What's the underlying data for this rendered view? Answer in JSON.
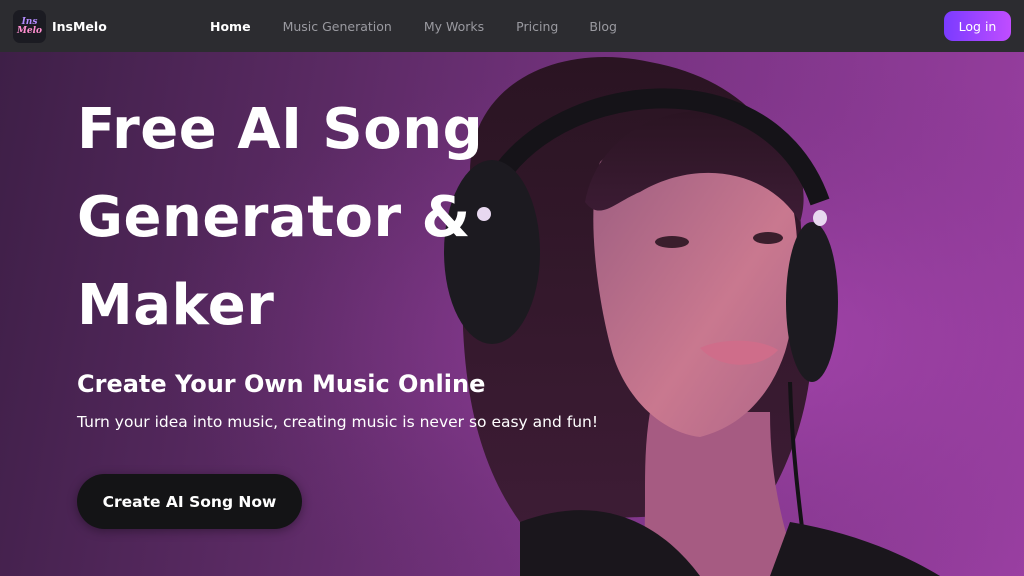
{
  "brand": {
    "logo_text_line1": "Ins",
    "logo_text_line2": "Melo",
    "name": "InsMelo"
  },
  "nav": {
    "items": [
      {
        "label": "Home",
        "active": true
      },
      {
        "label": "Music Generation",
        "active": false
      },
      {
        "label": "My Works",
        "active": false
      },
      {
        "label": "Pricing",
        "active": false
      },
      {
        "label": "Blog",
        "active": false
      }
    ],
    "login_label": "Log in"
  },
  "hero": {
    "title_line1": "Free AI Song",
    "title_line2": "Generator &",
    "title_line3": "Maker",
    "subtitle": "Create Your Own Music Online",
    "description": "Turn your idea into music, creating music is never so easy and fun!",
    "cta_label": "Create AI Song Now",
    "image": "woman-with-headphones-photo"
  },
  "colors": {
    "nav_bg": "#2c2c30",
    "accent_gradient_start": "#7a3bff",
    "accent_gradient_end": "#c04dff",
    "hero_purple": "#7a3484",
    "cta_bg": "#141416"
  }
}
